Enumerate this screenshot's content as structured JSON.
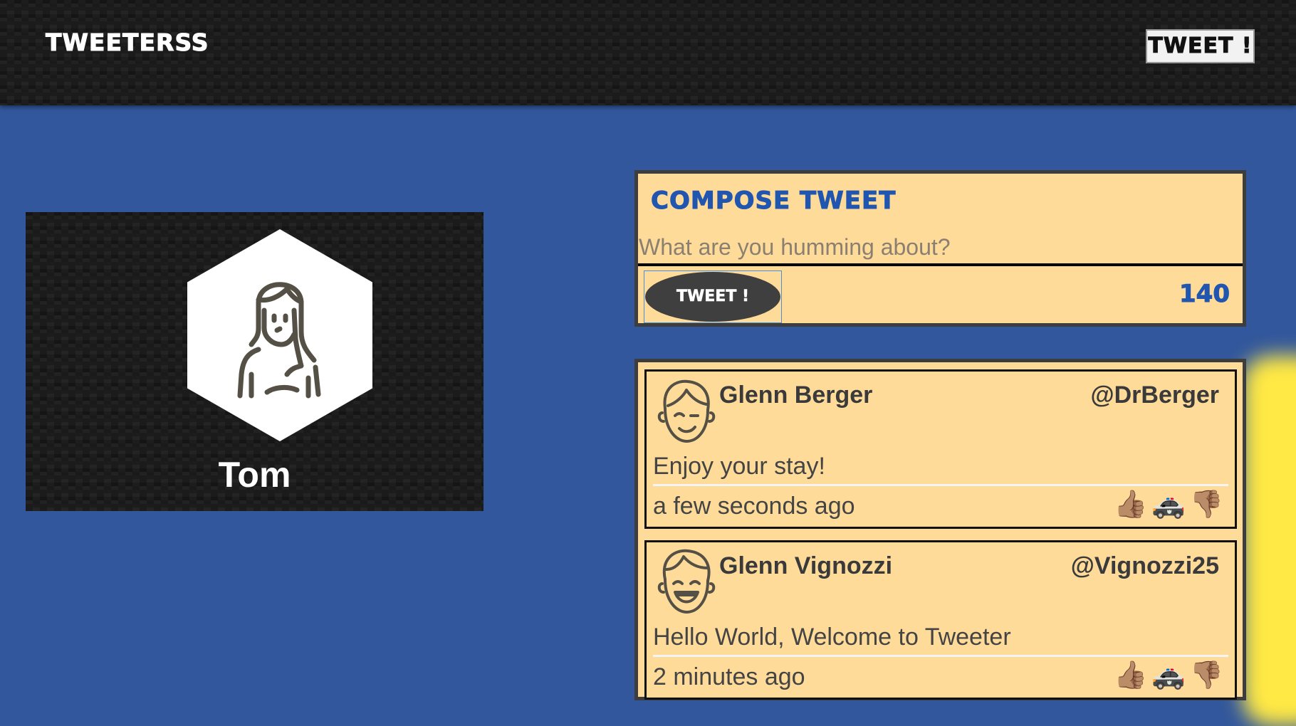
{
  "nav": {
    "brand": "TWEETERSS",
    "tweet_button": "TWEET !"
  },
  "profile": {
    "name": "Tom",
    "avatar_icon": "woman-avatar-icon"
  },
  "compose": {
    "title": "COMPOSE TWEET",
    "placeholder": "What are you humming about?",
    "value": "",
    "submit_label": "TWEET !",
    "char_count": "140"
  },
  "tweets": [
    {
      "name": "Glenn Berger",
      "handle": "@DrBerger",
      "text": "Enjoy your stay!",
      "time": "a few seconds ago",
      "avatar_icon": "winking-man-avatar-icon",
      "actions": {
        "like": "👍🏽",
        "report": "🚓",
        "dislike": "👎🏽"
      }
    },
    {
      "name": "Glenn Vignozzi",
      "handle": "@Vignozzi25",
      "text": "Hello World, Welcome to Tweeter",
      "time": "2 minutes ago",
      "avatar_icon": "laughing-man-avatar-icon",
      "actions": {
        "like": "👍🏽",
        "report": "🚓",
        "dislike": "👎🏽"
      }
    }
  ],
  "colors": {
    "page_bg": "#32579c",
    "card_bg": "#ffdb99",
    "accent_blue": "#2156b0",
    "dark": "#3d3d3d",
    "glow": "#ffe944"
  }
}
